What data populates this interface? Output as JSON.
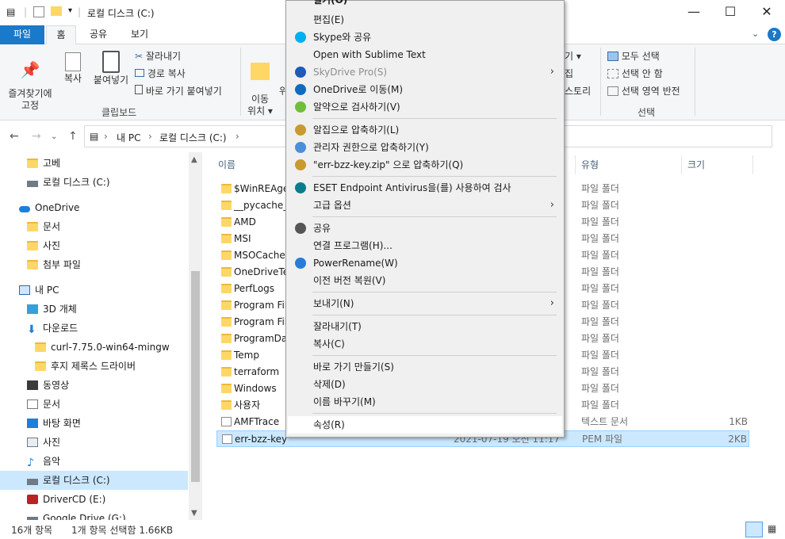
{
  "window": {
    "title": "로컬 디스크 (C:)"
  },
  "ribbon": {
    "tabs": [
      "파일",
      "홈",
      "공유",
      "보기"
    ],
    "clipboard": {
      "pin": "즐겨찾기에\n고정",
      "copy": "복사",
      "paste": "붙여넣기",
      "cut": "잘라내기",
      "copy_path": "경로 복사",
      "paste_shortcut": "바로 가기 붙여넣기",
      "group": "클립보드"
    },
    "organize": {
      "move_to": "이동\n위치 ▾",
      "partial_label": "위"
    },
    "open_partial": {
      "line1": "기 ▾",
      "line2": "집",
      "line3": "스토리"
    },
    "select": {
      "select_all": "모두 선택",
      "select_none": "선택 안 함",
      "invert": "선택 영역 반전",
      "group": "선택"
    }
  },
  "address": {
    "crumbs": [
      "내 PC",
      "로컬 디스크 (C:)"
    ]
  },
  "nav": {
    "items": [
      {
        "label": "고베",
        "icon": "folder-icon"
      },
      {
        "label": "로컬 디스크 (C:)",
        "icon": "drive-icon"
      },
      {
        "label": "OneDrive",
        "icon": "cloud-icon"
      },
      {
        "label": "문서",
        "icon": "folder-icon"
      },
      {
        "label": "사진",
        "icon": "folder-icon"
      },
      {
        "label": "첨부 파일",
        "icon": "folder-icon"
      },
      {
        "label": "내 PC",
        "icon": "pc-icon"
      },
      {
        "label": "3D 개체",
        "icon": "cube-icon"
      },
      {
        "label": "다운로드",
        "icon": "download-icon"
      },
      {
        "label": "curl-7.75.0-win64-mingw",
        "icon": "folder-icon"
      },
      {
        "label": "후지 제록스 드라이버",
        "icon": "folder-icon"
      },
      {
        "label": "동영상",
        "icon": "video-icon"
      },
      {
        "label": "문서",
        "icon": "document-icon"
      },
      {
        "label": "바탕 화면",
        "icon": "desktop-icon"
      },
      {
        "label": "사진",
        "icon": "picture-icon"
      },
      {
        "label": "음악",
        "icon": "music-icon"
      },
      {
        "label": "로컬 디스크 (C:)",
        "icon": "drive-icon"
      },
      {
        "label": "DriverCD (E:)",
        "icon": "disc-icon"
      },
      {
        "label": "Google Drive (G:)",
        "icon": "drive-icon"
      }
    ]
  },
  "files": {
    "columns": {
      "name": "이름",
      "type": "유형",
      "size": "크기"
    },
    "rows": [
      {
        "name": "$WinREAge",
        "type": "파일 폴더",
        "size": "",
        "kind": "folder"
      },
      {
        "name": "__pycache_",
        "type": "파일 폴더",
        "size": "",
        "kind": "folder"
      },
      {
        "name": "AMD",
        "type": "파일 폴더",
        "size": "",
        "kind": "folder"
      },
      {
        "name": "MSI",
        "type": "파일 폴더",
        "size": "",
        "kind": "folder"
      },
      {
        "name": "MSOCache",
        "type": "파일 폴더",
        "size": "",
        "kind": "folder"
      },
      {
        "name": "OneDriveTe",
        "type": "파일 폴더",
        "size": "",
        "kind": "folder"
      },
      {
        "name": "PerfLogs",
        "type": "파일 폴더",
        "size": "",
        "kind": "folder"
      },
      {
        "name": "Program Fil",
        "type": "파일 폴더",
        "size": "",
        "kind": "folder"
      },
      {
        "name": "Program Fil",
        "type": "파일 폴더",
        "size": "",
        "kind": "folder"
      },
      {
        "name": "ProgramDat",
        "type": "파일 폴더",
        "size": "",
        "kind": "folder"
      },
      {
        "name": "Temp",
        "type": "파일 폴더",
        "size": "",
        "kind": "folder"
      },
      {
        "name": "terraform",
        "type": "파일 폴더",
        "size": "",
        "kind": "folder"
      },
      {
        "name": "Windows",
        "type": "파일 폴더",
        "size": "",
        "kind": "folder"
      },
      {
        "name": "사용자",
        "type": "파일 폴더",
        "size": "",
        "kind": "folder"
      },
      {
        "name": "AMFTrace",
        "type": "텍스트 문서",
        "size": "1KB",
        "kind": "file"
      },
      {
        "name": "err-bzz-key",
        "type": "PEM 파일",
        "size": "2KB",
        "kind": "file",
        "date": "2021-07-19 오전 11:17"
      }
    ]
  },
  "status": {
    "count": "16개 항목",
    "selection": "1개 항목 선택함 1.66KB"
  },
  "context_menu": {
    "items": [
      {
        "label": "열기(O)",
        "icon": ""
      },
      {
        "label": "편집(E)",
        "icon": ""
      },
      {
        "label": "Skype와 공유",
        "icon": "skype-icon"
      },
      {
        "label": "Open with Sublime Text",
        "icon": ""
      },
      {
        "label": "SkyDrive Pro(S)",
        "icon": "skydrive-icon"
      },
      {
        "label": "OneDrive로 이동(M)",
        "icon": "onedrive-icon"
      },
      {
        "label": "알약으로 검사하기(V)",
        "icon": "alyac-icon"
      },
      {
        "label": "알집으로 압축하기(L)",
        "icon": "alzip-icon"
      },
      {
        "label": "관리자 권한으로 압축하기(Y)",
        "icon": "alzip-admin-icon"
      },
      {
        "label": "\"err-bzz-key.zip\" 으로 압축하기(Q)",
        "icon": "alzip-icon"
      },
      {
        "label": "ESET Endpoint Antivirus을(를) 사용하여 검사",
        "icon": "eset-icon"
      },
      {
        "label": "고급 옵션",
        "icon": ""
      },
      {
        "label": "공유",
        "icon": "share-icon"
      },
      {
        "label": "연결 프로그램(H)...",
        "icon": ""
      },
      {
        "label": "PowerRename(W)",
        "icon": "powerrename-icon"
      },
      {
        "label": "이전 버전 복원(V)",
        "icon": ""
      },
      {
        "label": "보내기(N)",
        "icon": ""
      },
      {
        "label": "잘라내기(T)",
        "icon": ""
      },
      {
        "label": "복사(C)",
        "icon": ""
      },
      {
        "label": "바로 가기 만들기(S)",
        "icon": ""
      },
      {
        "label": "삭제(D)",
        "icon": ""
      },
      {
        "label": "이름 바꾸기(M)",
        "icon": ""
      },
      {
        "label": "속성(R)",
        "icon": ""
      }
    ]
  },
  "colors": {
    "accent": "#1979ca",
    "selection": "#cce8ff",
    "folder": "#ffd766"
  }
}
